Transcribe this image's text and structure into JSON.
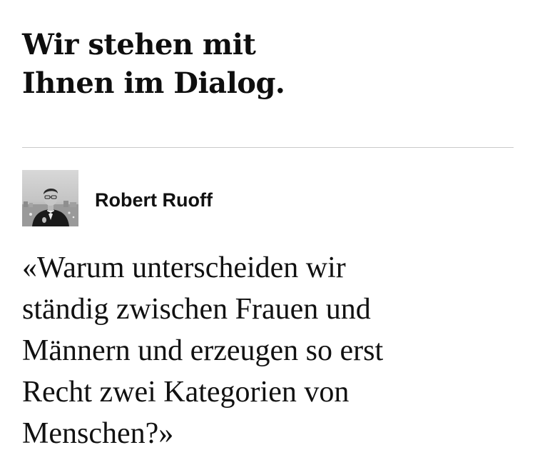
{
  "headline": {
    "lines": [
      "Wir stehen mit",
      "Ihnen im Dialog."
    ]
  },
  "author": {
    "name": "Robert Ruoff",
    "avatar_icon": "portrait-photo"
  },
  "quote": {
    "lines": [
      "«Warum unterscheiden wir",
      "ständig zwischen Frauen und",
      "Männern und erzeugen so erst",
      "Recht zwei Kategorien von",
      "Menschen?»"
    ]
  },
  "colors": {
    "text": "#111111",
    "divider": "#c9c9c9",
    "background": "#ffffff"
  }
}
